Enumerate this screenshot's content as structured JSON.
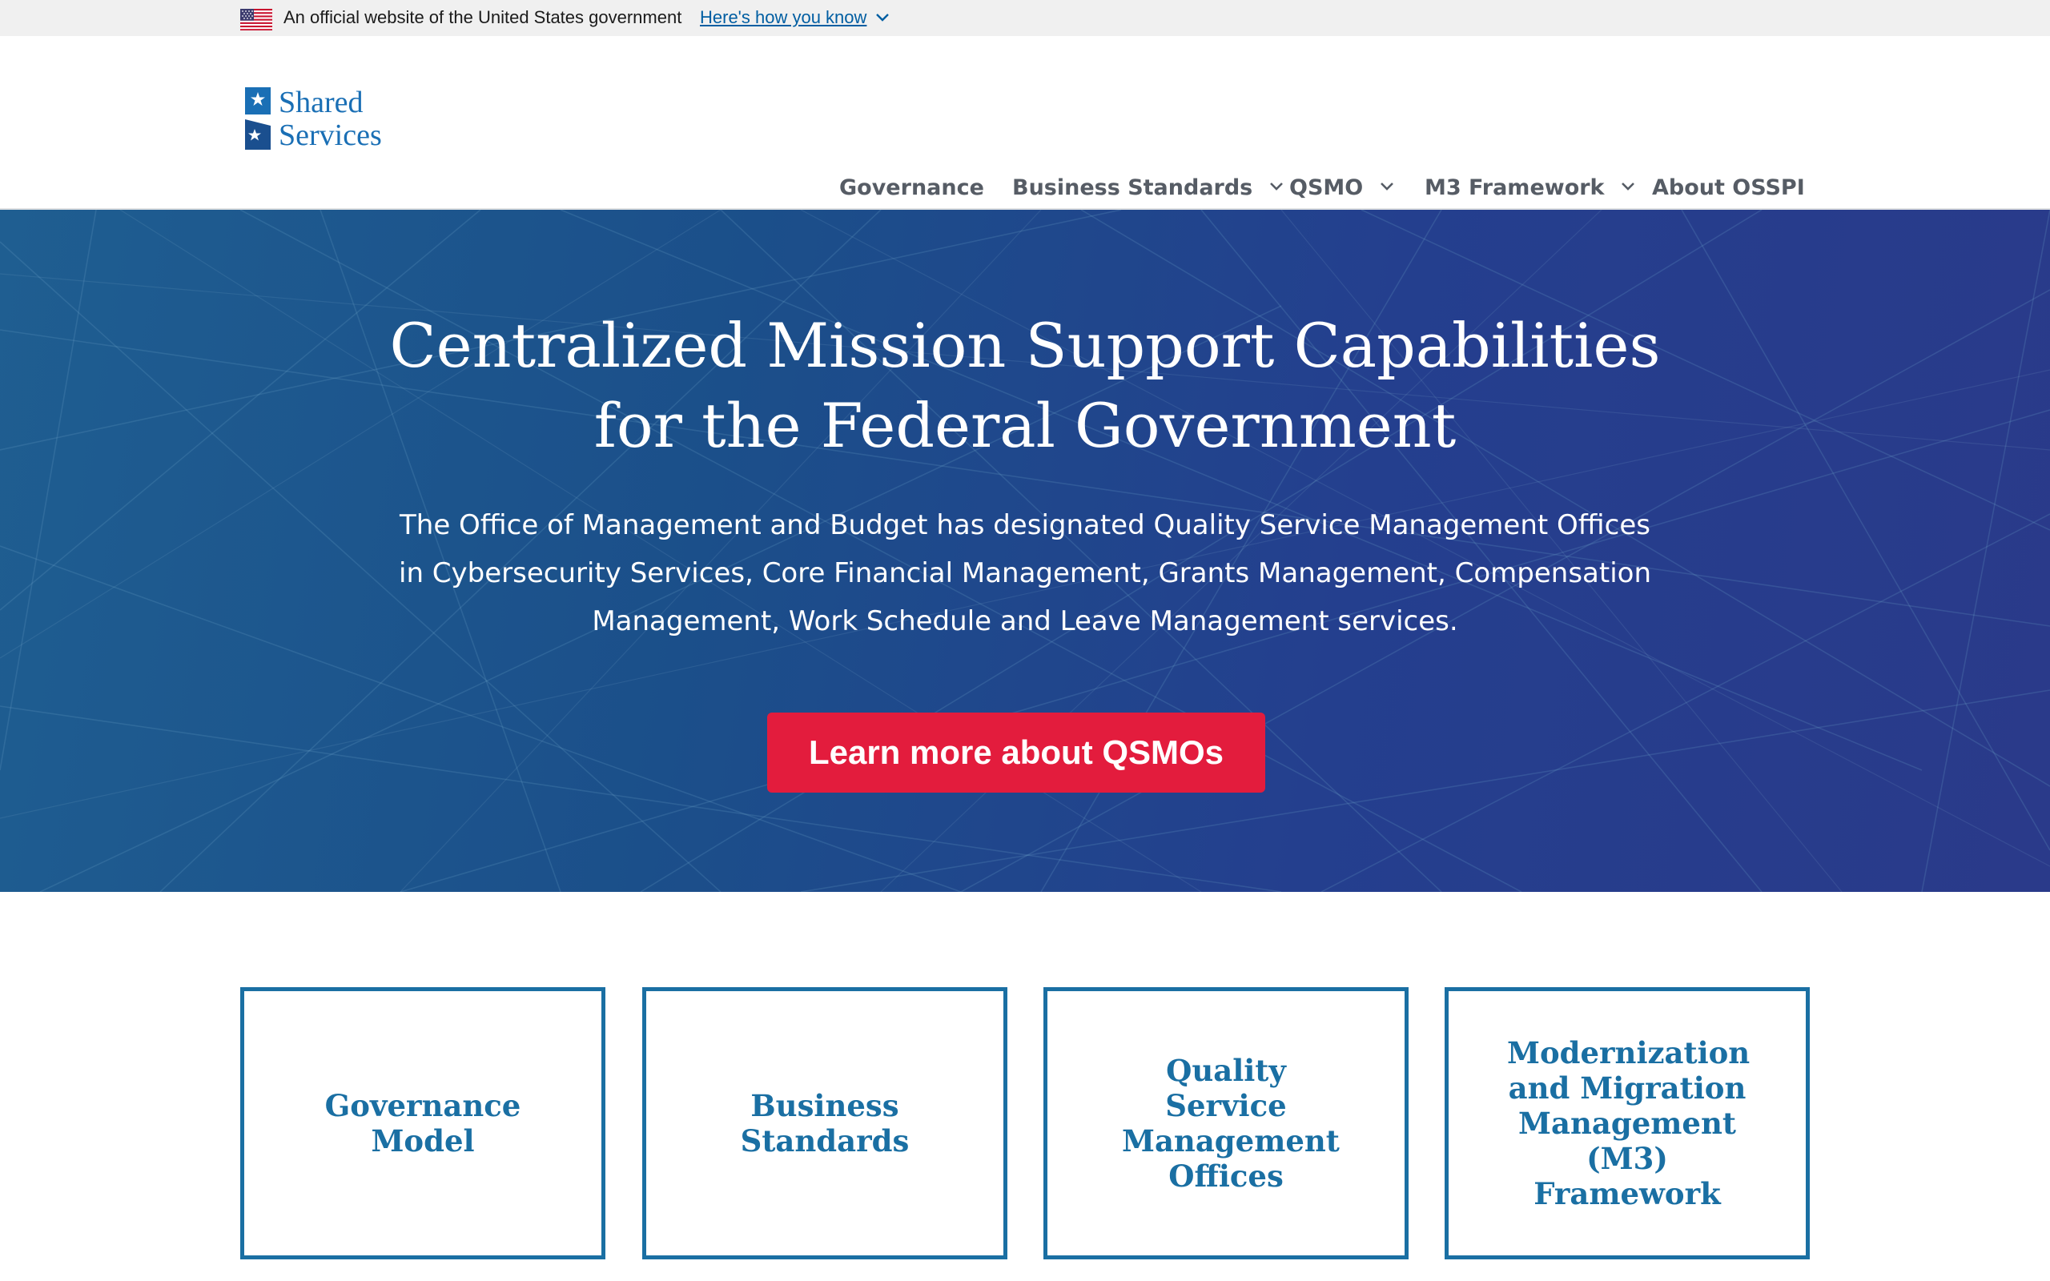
{
  "gov_banner": {
    "text": "An official website of the United States government",
    "link": "Here's how you know",
    "flag_icon": "us-flag-icon",
    "chevron_icon": "chevron-down-icon"
  },
  "logo": {
    "line1": "Shared",
    "line2": "Services",
    "mark_icon": "star-flag-logo-icon",
    "color": "#1a6fb5"
  },
  "nav": {
    "items": [
      {
        "label": "Governance",
        "has_dropdown": false
      },
      {
        "label": "Business Standards",
        "has_dropdown": true
      },
      {
        "label": "QSMO",
        "has_dropdown": true
      },
      {
        "label": "M3 Framework",
        "has_dropdown": true
      },
      {
        "label": "About OSSPI",
        "has_dropdown": false
      }
    ]
  },
  "hero": {
    "title_line1": "Centralized Mission Support Capabilities",
    "title_line2": "for the Federal Government",
    "desc_line1": "The Office of Management and Budget has designated Quality Service Management Offices",
    "desc_line2": "in Cybersecurity Services, Core Financial Management, Grants Management, Compensation",
    "desc_line3": "Management, Work Schedule and Leave Management services.",
    "button": "Learn more about QSMOs",
    "button_color": "#e31c3d",
    "background_color": "#1f4f8c"
  },
  "cards": [
    {
      "lines": [
        "Governance",
        "Model"
      ]
    },
    {
      "lines": [
        "Business",
        "Standards"
      ]
    },
    {
      "lines": [
        "Quality",
        "Service",
        "Management",
        "Offices"
      ]
    },
    {
      "lines": [
        "Modernization",
        "and Migration",
        "Management",
        "(M3)",
        "Framework"
      ]
    }
  ],
  "colors": {
    "accent": "#1a6fa3",
    "link": "#005ea2",
    "nav_text": "#565c65"
  }
}
